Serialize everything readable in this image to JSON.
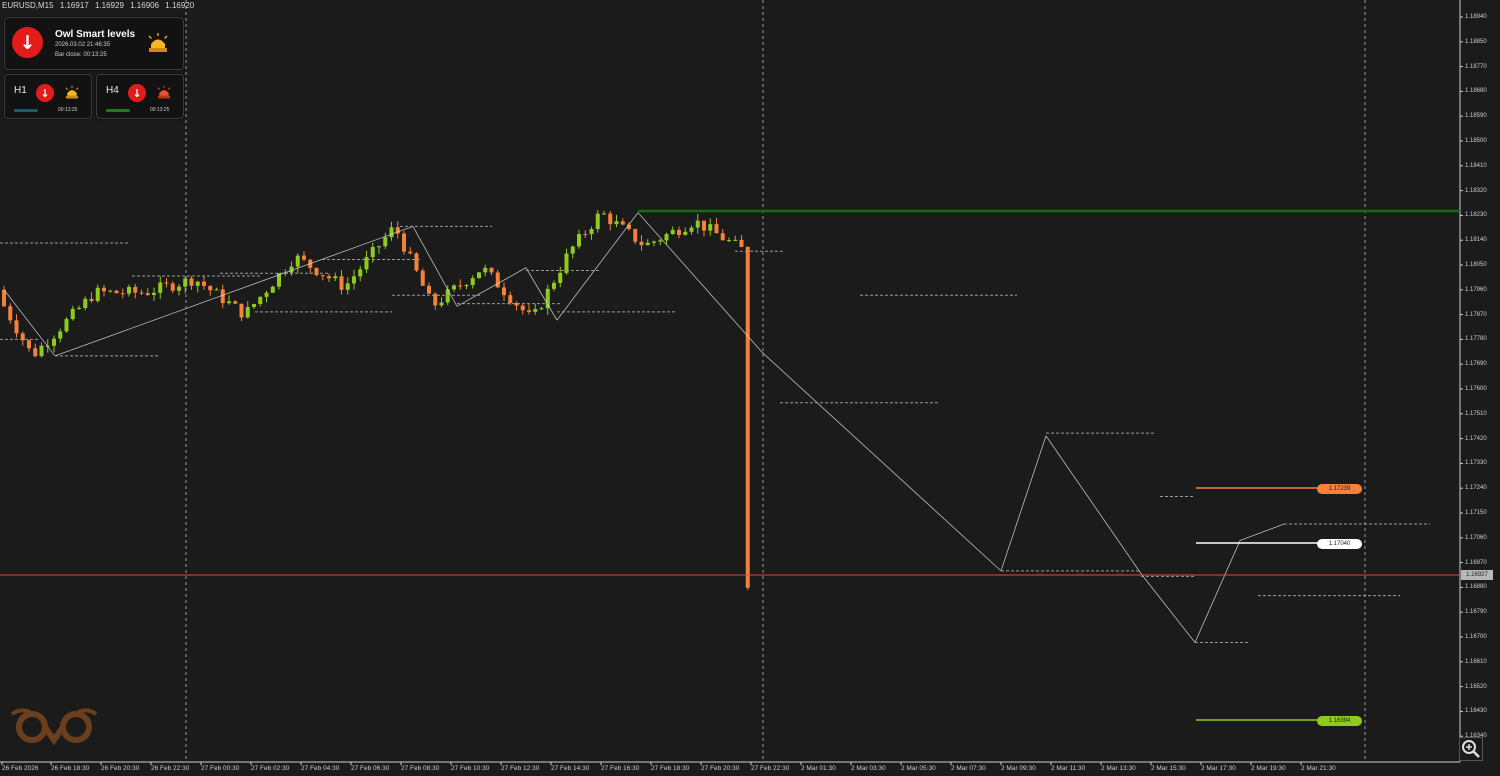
{
  "header": {
    "symbol": "EURUSD,M15",
    "open": "1.16917",
    "high": "1.16929",
    "low": "1.16906",
    "close": "1.16920"
  },
  "indicator": {
    "title": "Owl Smart levels",
    "datetime": "2026.03.02 21:46:35",
    "bar_close": "Bar close: 00:13:25",
    "signal_icon": "down-arrow-icon",
    "alarm_icon": "alarm-light-icon",
    "timeframes": [
      {
        "label": "H1",
        "time": "00:13:25",
        "bar_color": "#1e5a6e"
      },
      {
        "label": "H4",
        "time": "00:13:25",
        "bar_color": "#1e7a1e"
      }
    ]
  },
  "levels": {
    "resistance_top": {
      "price": "1.18276",
      "color": "#0f6e0f"
    },
    "orange": {
      "label": "1.17239",
      "color": "#f5823c"
    },
    "white": {
      "label": "1.17040",
      "color": "#ffffff"
    },
    "green": {
      "label": "1.16394",
      "color": "#8fcb1e"
    },
    "current": {
      "label": "1.16927",
      "color": "#d94a4a"
    }
  },
  "y_axis": [
    "1.18940",
    "1.18850",
    "1.18770",
    "1.18680",
    "1.18590",
    "1.18500",
    "1.18410",
    "1.18320",
    "1.18230",
    "1.18140",
    "1.18050",
    "1.17960",
    "1.17870",
    "1.17780",
    "1.17690",
    "1.17600",
    "1.17510",
    "1.17420",
    "1.17330",
    "1.17240",
    "1.17150",
    "1.17060",
    "1.16970",
    "1.16880",
    "1.16790",
    "1.16700",
    "1.16610",
    "1.16520",
    "1.16430",
    "1.16340"
  ],
  "x_axis": [
    "26 Feb 2026",
    "26 Feb 18:30",
    "26 Feb 20:30",
    "26 Feb 22:30",
    "27 Feb 00:30",
    "27 Feb 02:30",
    "27 Feb 04:30",
    "27 Feb 06:30",
    "27 Feb 08:30",
    "27 Feb 10:30",
    "27 Feb 12:30",
    "27 Feb 14:30",
    "27 Feb 16:30",
    "27 Feb 18:30",
    "27 Feb 20:30",
    "27 Feb 22:30",
    "2 Mar 01:30",
    "2 Mar 03:30",
    "2 Mar 05:30",
    "2 Mar 07:30",
    "2 Mar 09:30",
    "2 Mar 11:30",
    "2 Mar 13:30",
    "2 Mar 15:30",
    "2 Mar 17:30",
    "2 Mar 19:30",
    "2 Mar 21:30"
  ],
  "colors": {
    "background": "#1b1b1b",
    "bull": "#8fcb1e",
    "bear": "#f5823c",
    "grid": "#cfcfcf",
    "zigzag": "#d8d8d8",
    "level_dotted": "#9a9a9a"
  },
  "chart_data": {
    "type": "candlestick",
    "symbol": "EURUSD",
    "timeframe": "M15",
    "ylim": [
      1.163,
      1.1898
    ],
    "grid": false,
    "price_path": [
      [
        "26 Feb 16:30",
        1.1799
      ],
      [
        "26 Feb 18:00",
        1.1775
      ],
      [
        "26 Feb 20:30",
        1.1798
      ],
      [
        "26 Feb 22:30",
        1.1798
      ],
      [
        "27 Feb 00:30",
        1.1803
      ],
      [
        "27 Feb 02:30",
        1.179
      ],
      [
        "27 Feb 04:30",
        1.1811
      ],
      [
        "27 Feb 06:30",
        1.18
      ],
      [
        "27 Feb 08:30",
        1.1822
      ],
      [
        "27 Feb 10:00",
        1.1793
      ],
      [
        "27 Feb 12:00",
        1.1807
      ],
      [
        "27 Feb 14:00",
        1.1788
      ],
      [
        "27 Feb 15:30",
        1.1813
      ],
      [
        "27 Feb 16:45",
        1.1827
      ],
      [
        "27 Feb 18:30",
        1.1815
      ],
      [
        "27 Feb 20:30",
        1.1824
      ],
      [
        "27 Feb 22:30",
        1.1813
      ],
      [
        "2 Mar 00:00",
        1.177
      ],
      [
        "2 Mar 01:00",
        1.1758
      ],
      [
        "2 Mar 02:00",
        1.1793
      ],
      [
        "2 Mar 03:00",
        1.1786
      ],
      [
        "2 Mar 04:00",
        1.1795
      ],
      [
        "2 Mar 05:30",
        1.178
      ],
      [
        "2 Mar 07:00",
        1.174
      ],
      [
        "2 Mar 08:30",
        1.1705
      ],
      [
        "2 Mar 09:30",
        1.1697
      ],
      [
        "2 Mar 10:30",
        1.1735
      ],
      [
        "2 Mar 11:30",
        1.1746
      ],
      [
        "2 Mar 13:00",
        1.1715
      ],
      [
        "2 Mar 14:30",
        1.1695
      ],
      [
        "2 Mar 15:30",
        1.1724
      ],
      [
        "2 Mar 16:30",
        1.168
      ],
      [
        "2 Mar 17:00",
        1.1671
      ],
      [
        "2 Mar 18:00",
        1.1698
      ],
      [
        "2 Mar 19:30",
        1.1714
      ],
      [
        "2 Mar 20:30",
        1.1679
      ],
      [
        "2 Mar 21:30",
        1.1692
      ]
    ],
    "horizontal_levels": [
      1.18276,
      1.17239,
      1.1704,
      1.16927,
      1.16394
    ]
  }
}
